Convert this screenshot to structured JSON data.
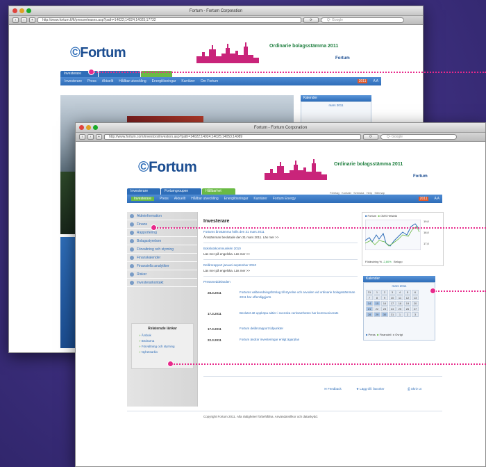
{
  "back_window": {
    "title": "Fortum - Fortum Corporation",
    "url": "http://www.fortum.fi/fi/pressreleases.asp?path=14022;14024;14025;17732",
    "search_placeholder": "Q- Google",
    "logo": "Fortum",
    "agm_title": "Ordinarie bolagsstämma 2011",
    "agm_brand": "Fortum",
    "tabs": [
      "Investerare",
      ""
    ],
    "nav": [
      "Investerare",
      "Press",
      "Aktuellt",
      "Hållbar utveckling",
      "Energilösningar",
      "Karriärer",
      "Om Fortum"
    ],
    "calendar_label": "Kalender",
    "calendar_month": "mars 2011",
    "nav_badge": "2011"
  },
  "front_window": {
    "title": "Fortum - Fortum Corporation",
    "url": "http://www.fortum.com/investors/investors.asp?path=14022;14024;14025;14053;14089",
    "search_placeholder": "Q- Google",
    "logo": "Fortum",
    "agm_title": "Ordinarie bolagsstämma 2011",
    "agm_brand": "Fortum",
    "tabs": [
      "Investerare",
      "Fortumgroupen",
      "Hållbarhet"
    ],
    "top_links": [
      "Företag",
      "Kontakt",
      "Svenska",
      "Help",
      "Sitemap"
    ],
    "nav": [
      "Investerare",
      "Press",
      "Aktuellt",
      "Hållbar utveckling",
      "Energilösningar",
      "Karriärer",
      "Fortum Energy"
    ],
    "nav_badge": "2011",
    "sidebar": [
      "Aktieinformation",
      "Finans",
      "Rapportering",
      "Bolagsstyrelsen",
      "Förvaltning och styrning",
      "Finanskalender",
      "Finansiella analytiker",
      "Risker",
      "Investerarkontakt"
    ],
    "related_links_title": "Relaterade länkar",
    "related_links": [
      "Årsbok",
      "Bedrarna",
      "Förvaltning och styrning",
      "Nyhetsarkiv"
    ],
    "main_heading": "Investerare",
    "news": [
      {
        "title": "Fortums årsstämma hölls den 31 mars 2011",
        "body": "Årsstämman beslutade den 31 mars 2011. Läs mer >>"
      },
      {
        "title": "Bokslutskommunikén 2010",
        "body": "Läs mer på engelska. Läs mer >>"
      },
      {
        "title": "Delårsrapport januari-september 2010",
        "body": "Läs mer på engelska. Läs mer >>"
      }
    ],
    "press_heading": "Pressmeddelanden",
    "press": [
      {
        "date": "28.3.2011",
        "text": "Fortums valberedningsförslag till styrelse och arvoden vid ordinarie bolagsstämman 2011 har offentliggjorts"
      },
      {
        "date": "17.3.2011",
        "text": "Beslutet att uppköpa aktier i svenska verksamheten har kommunicerats"
      },
      {
        "date": "17.3.2011",
        "text": "Fortum delårsrapport tidpunkter"
      },
      {
        "date": "22.3.2011",
        "text": "Fortum ändrar investeringar enligt ägarplan"
      }
    ],
    "chart_legend": [
      "Fortum",
      "OMX Helsinki"
    ],
    "chart_y": [
      "19,0",
      "18,0",
      "17,0"
    ],
    "chart_footer": "Förändring %",
    "chart_change": "-2,80%",
    "chart_currency": "Belopp",
    "calendar_label": "Kalender",
    "calendar_month": "mars 2011",
    "calendar_days": [
      "31",
      "1",
      "2",
      "3",
      "4",
      "5",
      "6",
      "7",
      "8",
      "9",
      "10",
      "11",
      "12",
      "13",
      "14",
      "15",
      "16",
      "17",
      "18",
      "19",
      "20",
      "21",
      "22",
      "23",
      "24",
      "25",
      "26",
      "27",
      "28",
      "29",
      "30",
      "31",
      "1",
      "2",
      "3"
    ],
    "calendar_legend": [
      "Press",
      "Finansiell",
      "Övrigt"
    ],
    "footer_actions": [
      "Feedback",
      "Lägg till i favoriter",
      "Skriv ut"
    ],
    "footer": "Copyright Fortum 2011. Alla rättigheter förbehållna. Användarvillkor och dataskydd."
  }
}
